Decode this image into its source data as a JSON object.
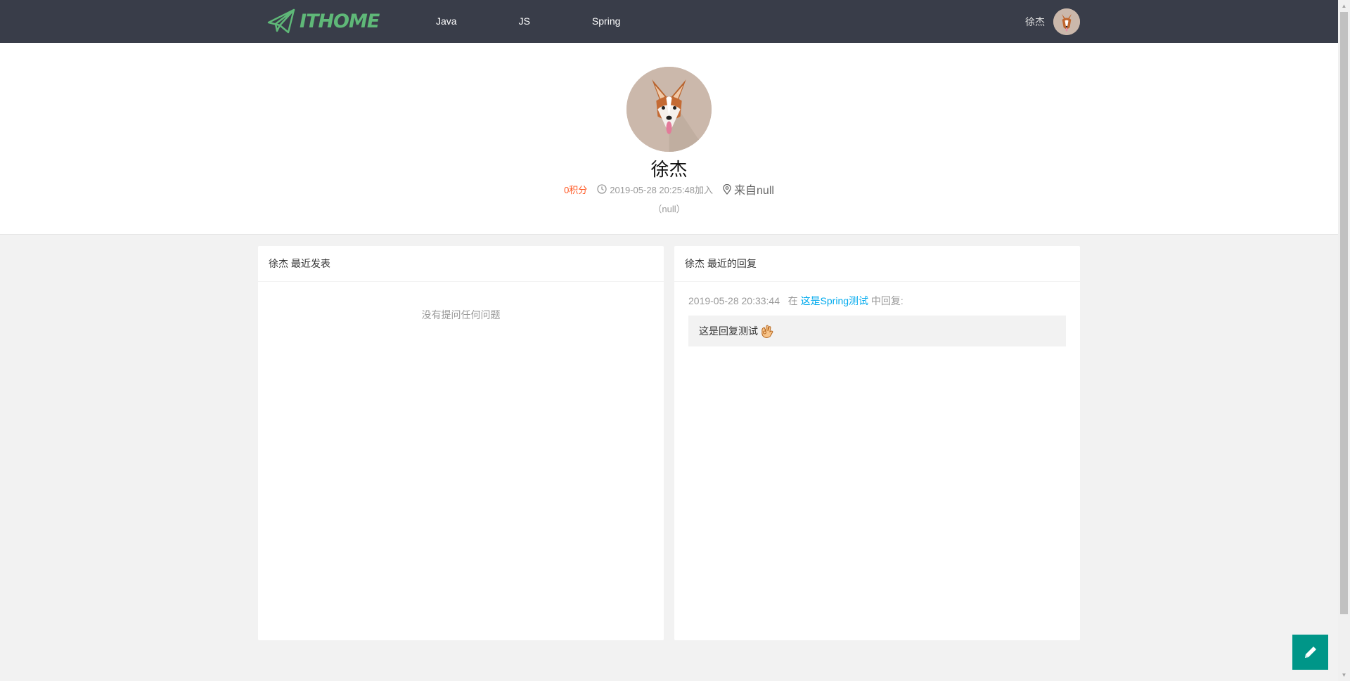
{
  "header": {
    "logo_text": "ITHOME",
    "nav": [
      {
        "label": "Java"
      },
      {
        "label": "JS"
      },
      {
        "label": "Spring"
      }
    ],
    "username": "徐杰"
  },
  "profile": {
    "name": "徐杰",
    "points": "0积分",
    "joined": "2019-05-28 20:25:48加入",
    "location": "来自null",
    "sign": "（null）"
  },
  "posts_panel": {
    "title": "徐杰 最近发表",
    "empty_text": "没有提问任何问题"
  },
  "replies_panel": {
    "title": "徐杰 最近的回复",
    "reply_time": "2019-05-28 20:33:44",
    "in_label": "在",
    "post_link": "这是Spring测试",
    "suffix": "中回复:",
    "reply_text": "这是回复测试"
  },
  "colors": {
    "header_bg": "#393d49",
    "logo_green": "#5fb878",
    "points_orange": "#ff5722",
    "link_blue": "#01aaed",
    "fab_teal": "#009688"
  }
}
